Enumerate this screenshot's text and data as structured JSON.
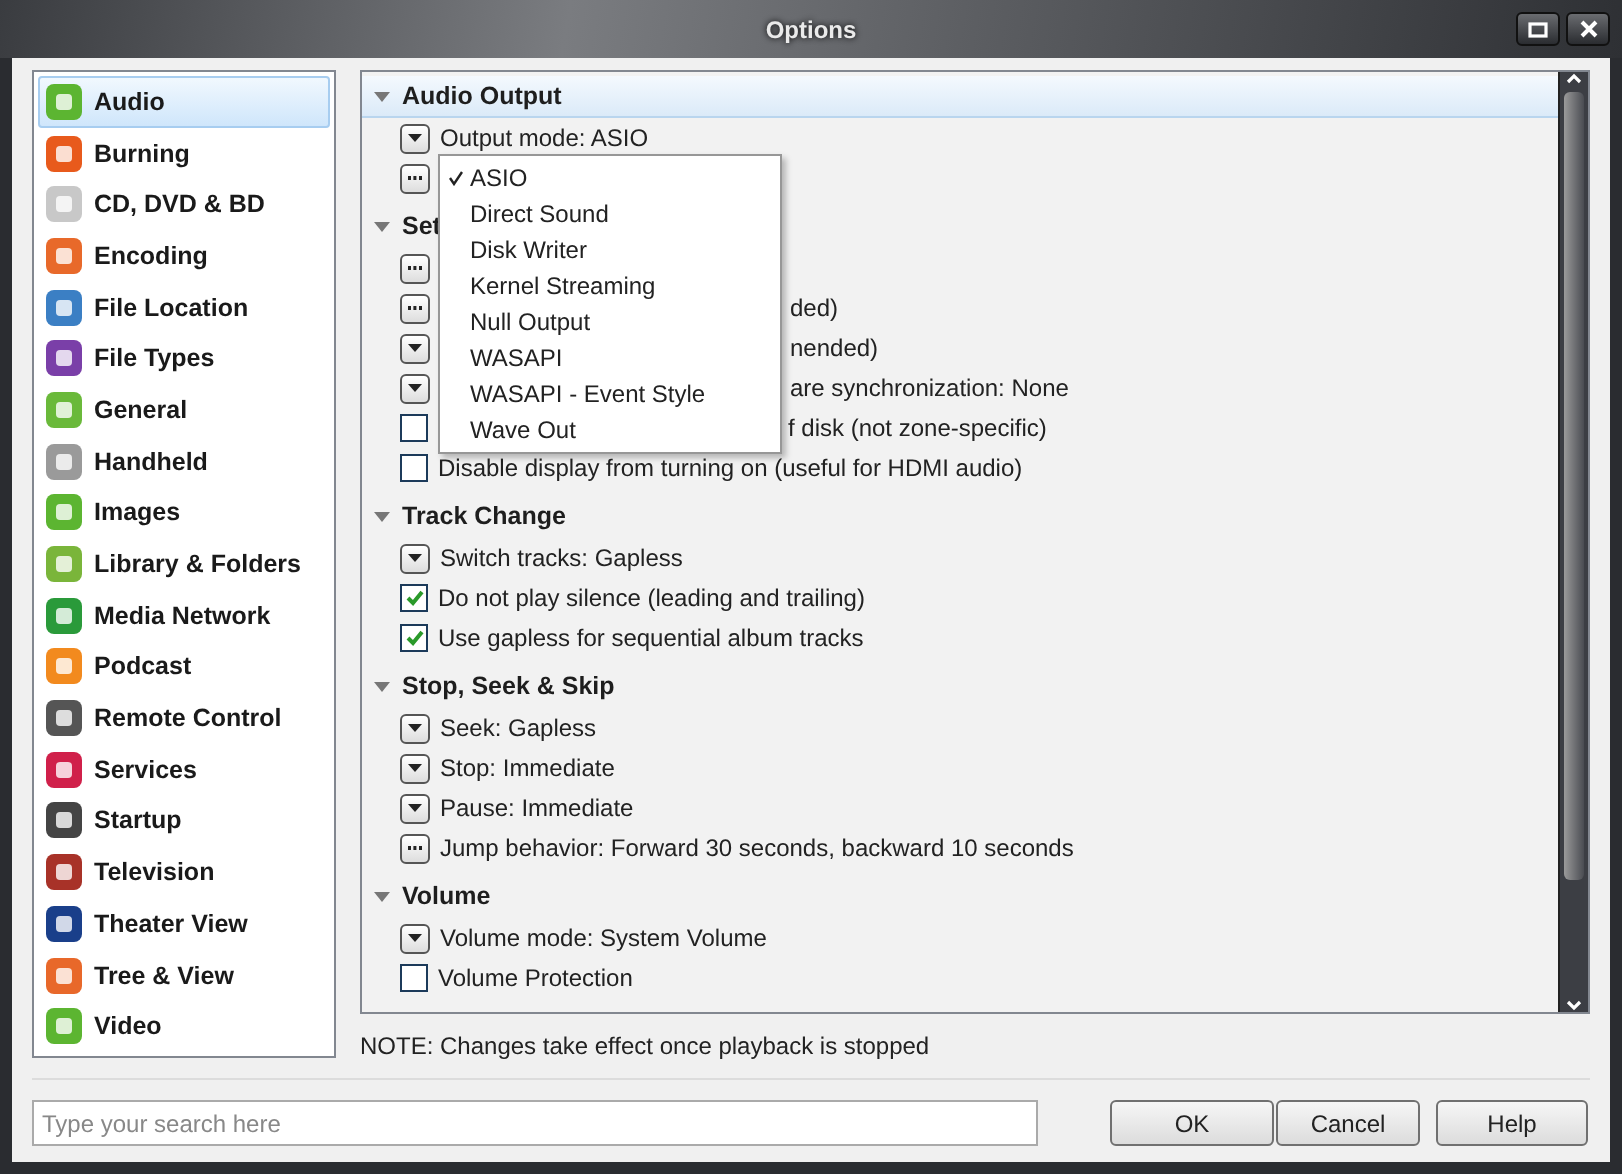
{
  "window": {
    "title": "Options"
  },
  "sidebar": {
    "items": [
      {
        "label": "Audio",
        "selected": true
      },
      {
        "label": "Burning",
        "selected": false
      },
      {
        "label": "CD, DVD & BD",
        "selected": false
      },
      {
        "label": "Encoding",
        "selected": false
      },
      {
        "label": "File Location",
        "selected": false
      },
      {
        "label": "File Types",
        "selected": false
      },
      {
        "label": "General",
        "selected": false
      },
      {
        "label": "Handheld",
        "selected": false
      },
      {
        "label": "Images",
        "selected": false
      },
      {
        "label": "Library & Folders",
        "selected": false
      },
      {
        "label": "Media Network",
        "selected": false
      },
      {
        "label": "Podcast",
        "selected": false
      },
      {
        "label": "Remote Control",
        "selected": false
      },
      {
        "label": "Services",
        "selected": false
      },
      {
        "label": "Startup",
        "selected": false
      },
      {
        "label": "Television",
        "selected": false
      },
      {
        "label": "Theater View",
        "selected": false
      },
      {
        "label": "Tree & View",
        "selected": false
      },
      {
        "label": "Video",
        "selected": false
      }
    ]
  },
  "sections": [
    {
      "title": "Audio Output",
      "highlighted": true,
      "rows": [
        {
          "kind": "dropdown",
          "text": "Output mode: ASIO"
        },
        {
          "kind": "more"
        }
      ]
    },
    {
      "title": "Set",
      "highlighted": false,
      "rows": [
        {
          "kind": "more"
        },
        {
          "kind": "more",
          "text": "ded)",
          "occluded": true
        },
        {
          "kind": "dropdown",
          "text": "nended)",
          "occluded": true
        },
        {
          "kind": "dropdown",
          "text": "are synchronization: None",
          "occluded": true
        },
        {
          "kind": "checkbox",
          "checked": false,
          "text": "f disk (not zone-specific)",
          "occluded": true
        },
        {
          "kind": "checkbox",
          "checked": false,
          "text": "Disable display from turning on (useful for HDMI audio)",
          "occluded": false
        }
      ]
    },
    {
      "title": "Track Change",
      "highlighted": false,
      "rows": [
        {
          "kind": "dropdown",
          "text": "Switch tracks: Gapless"
        },
        {
          "kind": "checkbox",
          "checked": true,
          "text": "Do not play silence (leading and trailing)"
        },
        {
          "kind": "checkbox",
          "checked": true,
          "text": "Use gapless for sequential album tracks"
        }
      ]
    },
    {
      "title": "Stop, Seek & Skip",
      "highlighted": false,
      "rows": [
        {
          "kind": "dropdown",
          "text": "Seek: Gapless"
        },
        {
          "kind": "dropdown",
          "text": "Stop: Immediate"
        },
        {
          "kind": "dropdown",
          "text": "Pause: Immediate"
        },
        {
          "kind": "more",
          "text": "Jump behavior: Forward 30 seconds, backward 10 seconds"
        }
      ]
    },
    {
      "title": "Volume",
      "highlighted": false,
      "rows": [
        {
          "kind": "dropdown",
          "text": "Volume mode: System Volume"
        },
        {
          "kind": "checkbox",
          "checked": false,
          "text": "Volume Protection"
        }
      ]
    }
  ],
  "dropdown_menu": {
    "items": [
      {
        "label": "ASIO",
        "selected": true
      },
      {
        "label": "Direct Sound",
        "selected": false
      },
      {
        "label": "Disk Writer",
        "selected": false
      },
      {
        "label": "Kernel Streaming",
        "selected": false
      },
      {
        "label": "Null Output",
        "selected": false
      },
      {
        "label": "WASAPI",
        "selected": false
      },
      {
        "label": "WASAPI - Event Style",
        "selected": false
      },
      {
        "label": "Wave Out",
        "selected": false
      }
    ]
  },
  "note": "NOTE: Changes take effect once playback is stopped",
  "search": {
    "placeholder": "Type your search here"
  },
  "buttons": [
    "OK",
    "Cancel",
    "Help"
  ]
}
